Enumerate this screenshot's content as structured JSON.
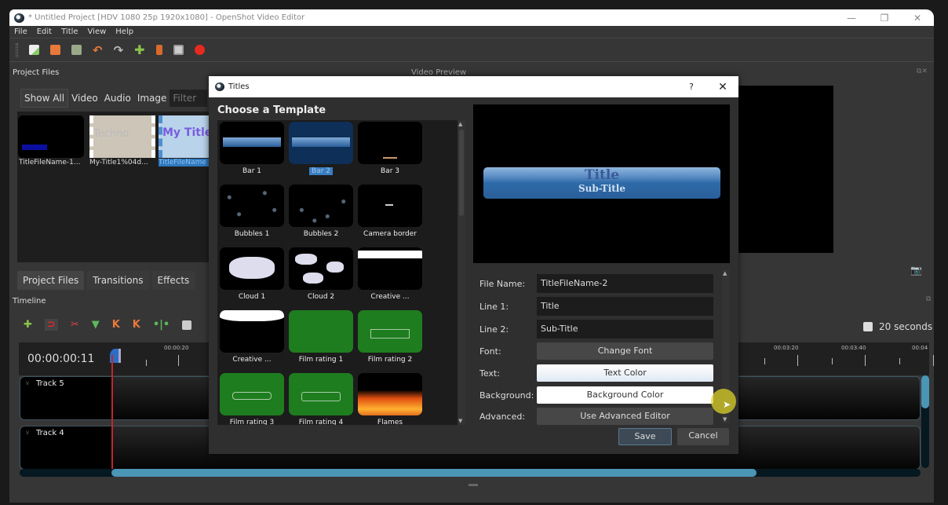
{
  "window": {
    "title": "* Untitled Project [HDV 1080 25p 1920x1080] - OpenShot Video Editor",
    "controls": [
      "minimize",
      "restore",
      "close"
    ]
  },
  "menu": [
    "File",
    "Edit",
    "Title",
    "View",
    "Help"
  ],
  "toolbar": {
    "icons": [
      "new-project-icon",
      "open-project-icon",
      "save-project-icon",
      "undo-icon",
      "redo-icon",
      "import-files-icon",
      "profile-icon",
      "fullscreen-icon",
      "export-video-icon"
    ]
  },
  "project_files": {
    "title": "Project Files",
    "filters": [
      "Show All",
      "Video",
      "Audio",
      "Image"
    ],
    "active_filter": "Show All",
    "filter_placeholder": "Filter",
    "files": [
      {
        "name": "TitleFileName-1..."
      },
      {
        "name": "My-Title1%04d...",
        "thumb_text": "Techno"
      },
      {
        "name": "TitleFileName",
        "thumb_text": "My Title",
        "selected": true
      }
    ]
  },
  "bottom_tabs": [
    "Project Files",
    "Transitions",
    "Effects"
  ],
  "video_preview": {
    "title": "Video Preview"
  },
  "timeline": {
    "title": "Timeline",
    "timecode": "00:00:00:11",
    "zoom_label": "20 seconds",
    "ruler_labels": [
      "00:00:20",
      "00:03:20",
      "00:03:40",
      "00:04"
    ],
    "tracks": [
      "Track 5",
      "Track 4"
    ],
    "hscroll_fraction": 0.72,
    "tools": [
      "add-track-icon",
      "snap-icon",
      "razor-icon",
      "add-marker-icon",
      "previous-marker-icon",
      "next-marker-icon",
      "center-playhead-icon",
      "zoom-icon"
    ]
  },
  "dialog": {
    "title": "Titles",
    "help": "?",
    "close": "✕",
    "choose_label": "Choose a Template",
    "templates": [
      {
        "name": "Bar 1"
      },
      {
        "name": "Bar 2",
        "selected": true
      },
      {
        "name": "Bar 3"
      },
      {
        "name": "Bubbles 1"
      },
      {
        "name": "Bubbles 2"
      },
      {
        "name": "Camera border"
      },
      {
        "name": "Cloud 1"
      },
      {
        "name": "Cloud 2"
      },
      {
        "name": "Creative ..."
      },
      {
        "name": "Creative ..."
      },
      {
        "name": "Film rating 1"
      },
      {
        "name": "Film rating 2"
      },
      {
        "name": "Film rating 3"
      },
      {
        "name": "Film rating 4"
      },
      {
        "name": "Flames"
      }
    ],
    "preview": {
      "title": "Title",
      "subtitle": "Sub-Title"
    },
    "form": {
      "file_name_label": "File Name:",
      "file_name_value": "TitleFileName-2",
      "line1_label": "Line 1:",
      "line1_value": "Title",
      "line2_label": "Line 2:",
      "line2_value": "Sub-Title",
      "font_label": "Font:",
      "font_button": "Change Font",
      "text_label": "Text:",
      "text_button": "Text Color",
      "background_label": "Background:",
      "background_button": "Background Color",
      "advanced_label": "Advanced:",
      "advanced_button": "Use Advanced Editor"
    },
    "save": "Save",
    "cancel": "Cancel"
  },
  "colors": {
    "accent": "#4b95b5",
    "playhead": "#c0272d",
    "selection": "#3a7ec0",
    "film_rating_green": "#1e7d1e"
  }
}
